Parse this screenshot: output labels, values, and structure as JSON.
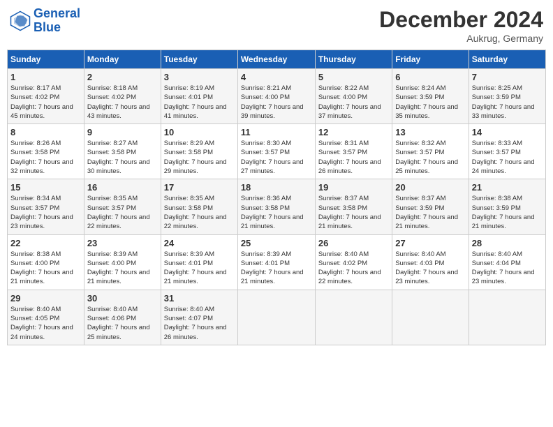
{
  "header": {
    "logo_line1": "General",
    "logo_line2": "Blue",
    "month": "December 2024",
    "location": "Aukrug, Germany"
  },
  "days_of_week": [
    "Sunday",
    "Monday",
    "Tuesday",
    "Wednesday",
    "Thursday",
    "Friday",
    "Saturday"
  ],
  "weeks": [
    [
      {
        "day": "1",
        "sunrise": "Sunrise: 8:17 AM",
        "sunset": "Sunset: 4:02 PM",
        "daylight": "Daylight: 7 hours and 45 minutes."
      },
      {
        "day": "2",
        "sunrise": "Sunrise: 8:18 AM",
        "sunset": "Sunset: 4:02 PM",
        "daylight": "Daylight: 7 hours and 43 minutes."
      },
      {
        "day": "3",
        "sunrise": "Sunrise: 8:19 AM",
        "sunset": "Sunset: 4:01 PM",
        "daylight": "Daylight: 7 hours and 41 minutes."
      },
      {
        "day": "4",
        "sunrise": "Sunrise: 8:21 AM",
        "sunset": "Sunset: 4:00 PM",
        "daylight": "Daylight: 7 hours and 39 minutes."
      },
      {
        "day": "5",
        "sunrise": "Sunrise: 8:22 AM",
        "sunset": "Sunset: 4:00 PM",
        "daylight": "Daylight: 7 hours and 37 minutes."
      },
      {
        "day": "6",
        "sunrise": "Sunrise: 8:24 AM",
        "sunset": "Sunset: 3:59 PM",
        "daylight": "Daylight: 7 hours and 35 minutes."
      },
      {
        "day": "7",
        "sunrise": "Sunrise: 8:25 AM",
        "sunset": "Sunset: 3:59 PM",
        "daylight": "Daylight: 7 hours and 33 minutes."
      }
    ],
    [
      {
        "day": "8",
        "sunrise": "Sunrise: 8:26 AM",
        "sunset": "Sunset: 3:58 PM",
        "daylight": "Daylight: 7 hours and 32 minutes."
      },
      {
        "day": "9",
        "sunrise": "Sunrise: 8:27 AM",
        "sunset": "Sunset: 3:58 PM",
        "daylight": "Daylight: 7 hours and 30 minutes."
      },
      {
        "day": "10",
        "sunrise": "Sunrise: 8:29 AM",
        "sunset": "Sunset: 3:58 PM",
        "daylight": "Daylight: 7 hours and 29 minutes."
      },
      {
        "day": "11",
        "sunrise": "Sunrise: 8:30 AM",
        "sunset": "Sunset: 3:57 PM",
        "daylight": "Daylight: 7 hours and 27 minutes."
      },
      {
        "day": "12",
        "sunrise": "Sunrise: 8:31 AM",
        "sunset": "Sunset: 3:57 PM",
        "daylight": "Daylight: 7 hours and 26 minutes."
      },
      {
        "day": "13",
        "sunrise": "Sunrise: 8:32 AM",
        "sunset": "Sunset: 3:57 PM",
        "daylight": "Daylight: 7 hours and 25 minutes."
      },
      {
        "day": "14",
        "sunrise": "Sunrise: 8:33 AM",
        "sunset": "Sunset: 3:57 PM",
        "daylight": "Daylight: 7 hours and 24 minutes."
      }
    ],
    [
      {
        "day": "15",
        "sunrise": "Sunrise: 8:34 AM",
        "sunset": "Sunset: 3:57 PM",
        "daylight": "Daylight: 7 hours and 23 minutes."
      },
      {
        "day": "16",
        "sunrise": "Sunrise: 8:35 AM",
        "sunset": "Sunset: 3:57 PM",
        "daylight": "Daylight: 7 hours and 22 minutes."
      },
      {
        "day": "17",
        "sunrise": "Sunrise: 8:35 AM",
        "sunset": "Sunset: 3:58 PM",
        "daylight": "Daylight: 7 hours and 22 minutes."
      },
      {
        "day": "18",
        "sunrise": "Sunrise: 8:36 AM",
        "sunset": "Sunset: 3:58 PM",
        "daylight": "Daylight: 7 hours and 21 minutes."
      },
      {
        "day": "19",
        "sunrise": "Sunrise: 8:37 AM",
        "sunset": "Sunset: 3:58 PM",
        "daylight": "Daylight: 7 hours and 21 minutes."
      },
      {
        "day": "20",
        "sunrise": "Sunrise: 8:37 AM",
        "sunset": "Sunset: 3:59 PM",
        "daylight": "Daylight: 7 hours and 21 minutes."
      },
      {
        "day": "21",
        "sunrise": "Sunrise: 8:38 AM",
        "sunset": "Sunset: 3:59 PM",
        "daylight": "Daylight: 7 hours and 21 minutes."
      }
    ],
    [
      {
        "day": "22",
        "sunrise": "Sunrise: 8:38 AM",
        "sunset": "Sunset: 4:00 PM",
        "daylight": "Daylight: 7 hours and 21 minutes."
      },
      {
        "day": "23",
        "sunrise": "Sunrise: 8:39 AM",
        "sunset": "Sunset: 4:00 PM",
        "daylight": "Daylight: 7 hours and 21 minutes."
      },
      {
        "day": "24",
        "sunrise": "Sunrise: 8:39 AM",
        "sunset": "Sunset: 4:01 PM",
        "daylight": "Daylight: 7 hours and 21 minutes."
      },
      {
        "day": "25",
        "sunrise": "Sunrise: 8:39 AM",
        "sunset": "Sunset: 4:01 PM",
        "daylight": "Daylight: 7 hours and 21 minutes."
      },
      {
        "day": "26",
        "sunrise": "Sunrise: 8:40 AM",
        "sunset": "Sunset: 4:02 PM",
        "daylight": "Daylight: 7 hours and 22 minutes."
      },
      {
        "day": "27",
        "sunrise": "Sunrise: 8:40 AM",
        "sunset": "Sunset: 4:03 PM",
        "daylight": "Daylight: 7 hours and 23 minutes."
      },
      {
        "day": "28",
        "sunrise": "Sunrise: 8:40 AM",
        "sunset": "Sunset: 4:04 PM",
        "daylight": "Daylight: 7 hours and 23 minutes."
      }
    ],
    [
      {
        "day": "29",
        "sunrise": "Sunrise: 8:40 AM",
        "sunset": "Sunset: 4:05 PM",
        "daylight": "Daylight: 7 hours and 24 minutes."
      },
      {
        "day": "30",
        "sunrise": "Sunrise: 8:40 AM",
        "sunset": "Sunset: 4:06 PM",
        "daylight": "Daylight: 7 hours and 25 minutes."
      },
      {
        "day": "31",
        "sunrise": "Sunrise: 8:40 AM",
        "sunset": "Sunset: 4:07 PM",
        "daylight": "Daylight: 7 hours and 26 minutes."
      },
      null,
      null,
      null,
      null
    ]
  ]
}
